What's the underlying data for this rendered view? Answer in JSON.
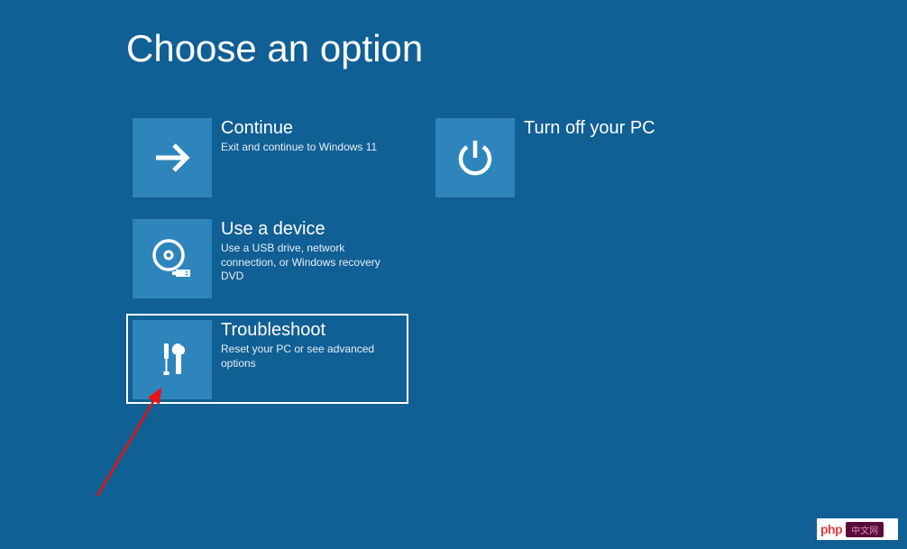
{
  "heading": "Choose an option",
  "tiles": {
    "continue": {
      "title": "Continue",
      "desc": "Exit and continue to Windows 11"
    },
    "turnoff": {
      "title": "Turn off your PC",
      "desc": ""
    },
    "device": {
      "title": "Use a device",
      "desc": "Use a USB drive, network connection, or Windows recovery DVD"
    },
    "troubleshoot": {
      "title": "Troubleshoot",
      "desc": "Reset your PC or see advanced options"
    }
  },
  "watermark": {
    "left": "php",
    "right": "中文网"
  }
}
